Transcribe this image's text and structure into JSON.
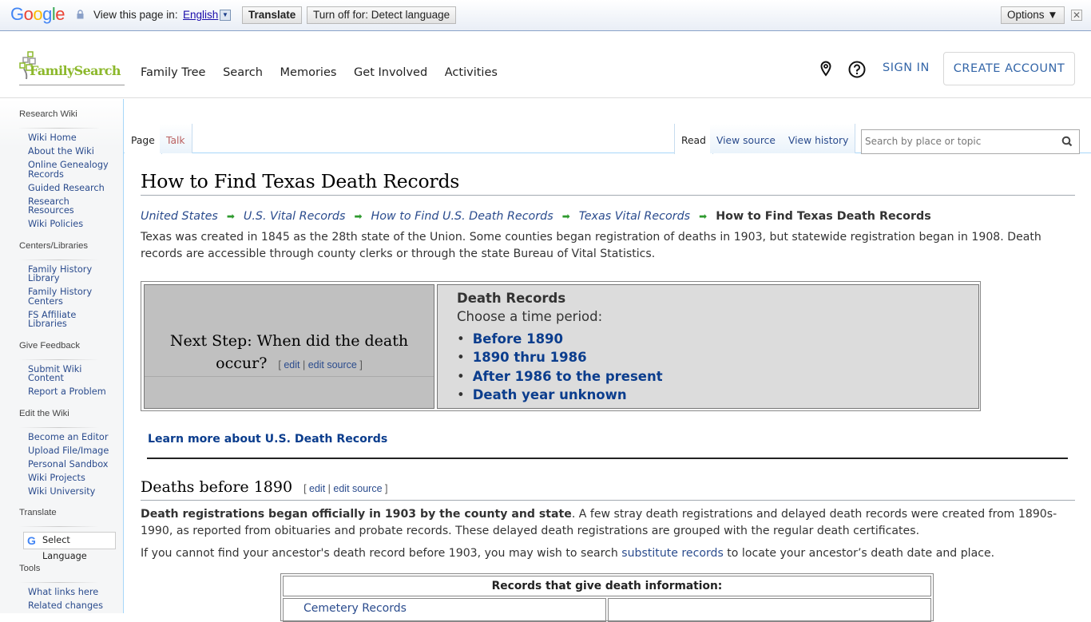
{
  "translate_bar": {
    "brand": "Google",
    "view_label": "View this page in:",
    "language": "English",
    "translate_button": "Translate",
    "turn_off_button": "Turn off for: Detect language",
    "options_button": "Options ▼",
    "close": "✕"
  },
  "header": {
    "logo": "FamilySearch",
    "nav": [
      "Family Tree",
      "Search",
      "Memories",
      "Get Involved",
      "Activities"
    ],
    "sign_in": "SIGN IN",
    "create_account": "CREATE ACCOUNT"
  },
  "sidebar": {
    "sections": [
      {
        "title": "Research Wiki",
        "items": [
          "Wiki Home",
          "About the Wiki",
          "Online Genealogy Records",
          "Guided Research",
          "Research Resources",
          "Wiki Policies"
        ]
      },
      {
        "title": "Centers/Libraries",
        "items": [
          "Family History Library",
          "Family History Centers",
          "FS Affiliate Libraries"
        ]
      },
      {
        "title": "Give Feedback",
        "items": [
          "Submit Wiki Content",
          "Report a Problem"
        ]
      },
      {
        "title": "Edit the Wiki",
        "items": [
          "Become an Editor",
          "Upload File/Image",
          "Personal Sandbox",
          "Wiki Projects",
          "Wiki University"
        ]
      }
    ],
    "translate_title": "Translate",
    "select_language": "Select Language",
    "tools_title": "Tools",
    "tools_items": [
      "What links here",
      "Related changes"
    ]
  },
  "tabs": {
    "page": "Page",
    "talk": "Talk",
    "read": "Read",
    "view_source": "View source",
    "view_history": "View history",
    "search_placeholder": "Search by place or topic"
  },
  "article": {
    "title": "How to Find Texas Death Records",
    "breadcrumbs": [
      "United States",
      "U.S. Vital Records",
      "How to Find U.S. Death Records",
      "Texas Vital Records"
    ],
    "breadcrumb_current": "How to Find Texas Death Records",
    "intro": "Texas was created in 1845 as the 28th state of the Union. Some counties began registration of deaths in 1903, but statewide registration began in 1908. Death records are accessible through county clerks or through the state Bureau of Vital Statistics.",
    "next_step": "Next Step: When did the death occur?",
    "edit": "edit",
    "edit_source": "edit source",
    "box_title": "Death Records",
    "box_choose": "Choose a time period:",
    "periods": [
      "Before 1890",
      "1890 thru 1986",
      "After 1986 to the present",
      "Death year unknown"
    ],
    "learn_more": "Learn more about U.S. Death Records",
    "section_title": "Deaths before 1890",
    "p1_bold": "Death registrations began officially in 1903 by the county and state",
    "p1_rest": ". A few stray death registrations and delayed death records were created from 1890s-1990, as reported from obituaries and probate records. These delayed death registrations are grouped with the regular death certificates.",
    "p2_before": "If you cannot find your ancestor's death record before 1903, you may wish to search ",
    "p2_link": "substitute records",
    "p2_after": " to locate your ancestor’s death date and place.",
    "table_header": "Records that give death information:",
    "table_cell_1": "Cemetery Records"
  }
}
